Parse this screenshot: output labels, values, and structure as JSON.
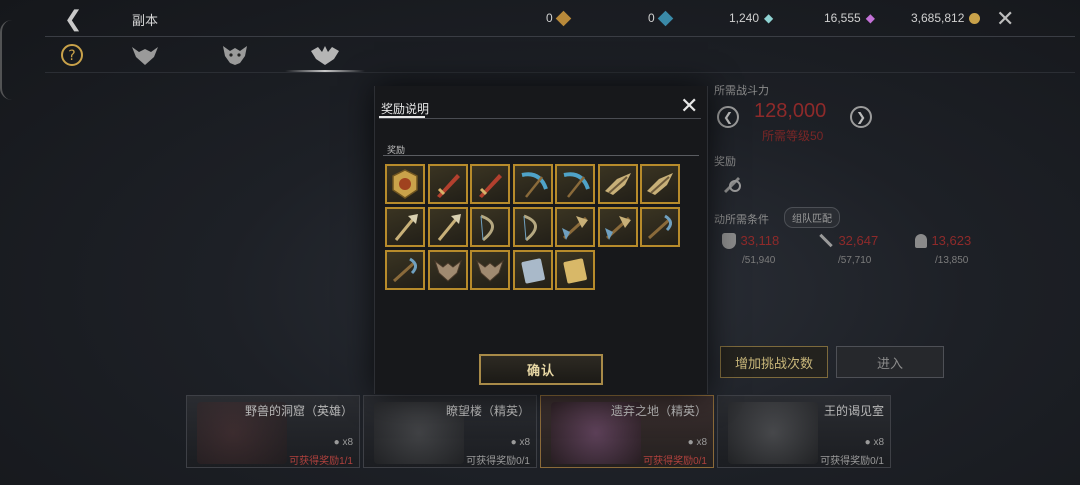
{
  "topbar": {
    "title": "副本",
    "currencies": [
      {
        "value": "0",
        "icon": "gold-crate-icon",
        "color": "#b8893a"
      },
      {
        "value": "0",
        "icon": "blue-crate-icon",
        "color": "#3a8aa8"
      },
      {
        "value": "1,240",
        "icon": "diamond-icon",
        "color": "#8fd3d3"
      },
      {
        "value": "16,555",
        "icon": "purple-gem-icon",
        "color": "#c472d8"
      },
      {
        "value": "3,685,812",
        "icon": "gold-coin-icon",
        "color": "#c9a24a"
      }
    ]
  },
  "tabs": [
    {
      "icon": "help-icon"
    },
    {
      "icon": "beast-mask-icon"
    },
    {
      "icon": "demon-mask-icon"
    },
    {
      "icon": "winged-demon-icon"
    }
  ],
  "right_panel": {
    "required_power_label": "所需战斗力",
    "required_power": "128,000",
    "required_level": "所需等级50",
    "reward_label": "奖励",
    "condition_label": "动所需条件",
    "team_tag": "组队匹配",
    "stats": [
      {
        "value": "33,118",
        "max": "/51,940",
        "icon": "shield-icon"
      },
      {
        "value": "32,647",
        "max": "/57,710",
        "icon": "sword-icon"
      },
      {
        "value": "13,623",
        "max": "/13,850",
        "icon": "helmet-icon"
      }
    ],
    "add_button": "增加挑战次数",
    "enter_button": "进入"
  },
  "dungeons": [
    {
      "name": "野兽的洞窟（英雄）",
      "count": "x8",
      "reward": "可获得奖励1/1",
      "selected": false,
      "reward_red": true
    },
    {
      "name": "瞭望楼（精英）",
      "count": "x8",
      "reward": "可获得奖励0/1",
      "selected": false,
      "reward_red": false
    },
    {
      "name": "遗弃之地（精英）",
      "count": "x8",
      "reward": "可获得奖励0/1",
      "selected": true,
      "reward_red": true
    },
    {
      "name": "王的谒见室",
      "count": "x8",
      "reward": "可获得奖励0/1",
      "selected": false,
      "reward_red": false
    }
  ],
  "modal": {
    "title": "奖励说明",
    "section_label": "奖励",
    "confirm_label": "确认",
    "items": [
      {
        "icon": "lion-emblem-icon"
      },
      {
        "icon": "red-sword-icon"
      },
      {
        "icon": "red-sword-icon"
      },
      {
        "icon": "blue-scythe-icon"
      },
      {
        "icon": "blue-scythe-icon"
      },
      {
        "icon": "winged-blade-icon"
      },
      {
        "icon": "winged-blade-icon"
      },
      {
        "icon": "ornate-staff-icon"
      },
      {
        "icon": "ornate-staff-icon"
      },
      {
        "icon": "recurve-bow-icon"
      },
      {
        "icon": "recurve-bow-icon"
      },
      {
        "icon": "dual-axe-icon"
      },
      {
        "icon": "dual-axe-icon"
      },
      {
        "icon": "hooked-blade-icon"
      },
      {
        "icon": "hooked-blade-icon"
      },
      {
        "icon": "horned-helm-icon"
      },
      {
        "icon": "horned-helm-icon"
      },
      {
        "icon": "blue-scroll-icon"
      },
      {
        "icon": "gold-scroll-icon"
      }
    ]
  }
}
